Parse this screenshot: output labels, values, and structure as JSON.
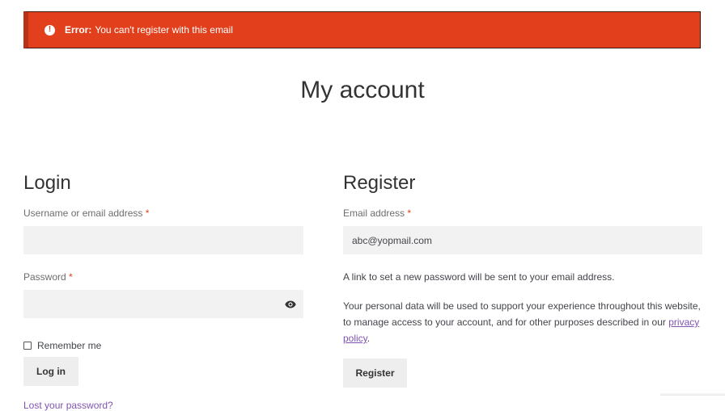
{
  "notice": {
    "icon": "exclamation-circle-icon",
    "label": "Error:",
    "message": "You can't register with this email"
  },
  "page": {
    "title": "My account"
  },
  "login": {
    "heading": "Login",
    "username_label": "Username or email address",
    "username_value": "",
    "password_label": "Password",
    "password_value": "",
    "required_mark": "*",
    "show_password_icon": "eye-icon",
    "remember_label": "Remember me",
    "submit_label": "Log in",
    "lost_password": "Lost your password?"
  },
  "register": {
    "heading": "Register",
    "email_label": "Email address",
    "email_value": "abc@yopmail.com",
    "required_mark": "*",
    "password_notice": "A link to set a new password will be sent to your email address.",
    "privacy_text": "Your personal data will be used to support your experience throughout this website, to manage access to your account, and for other purposes described in our",
    "privacy_link": "privacy policy",
    "privacy_end": ".",
    "submit_label": "Register"
  },
  "colors": {
    "error_bg": "#e2401c",
    "link": "#7f54b3",
    "input_bg": "#f2f2f2",
    "button_bg": "#eeeeee"
  }
}
